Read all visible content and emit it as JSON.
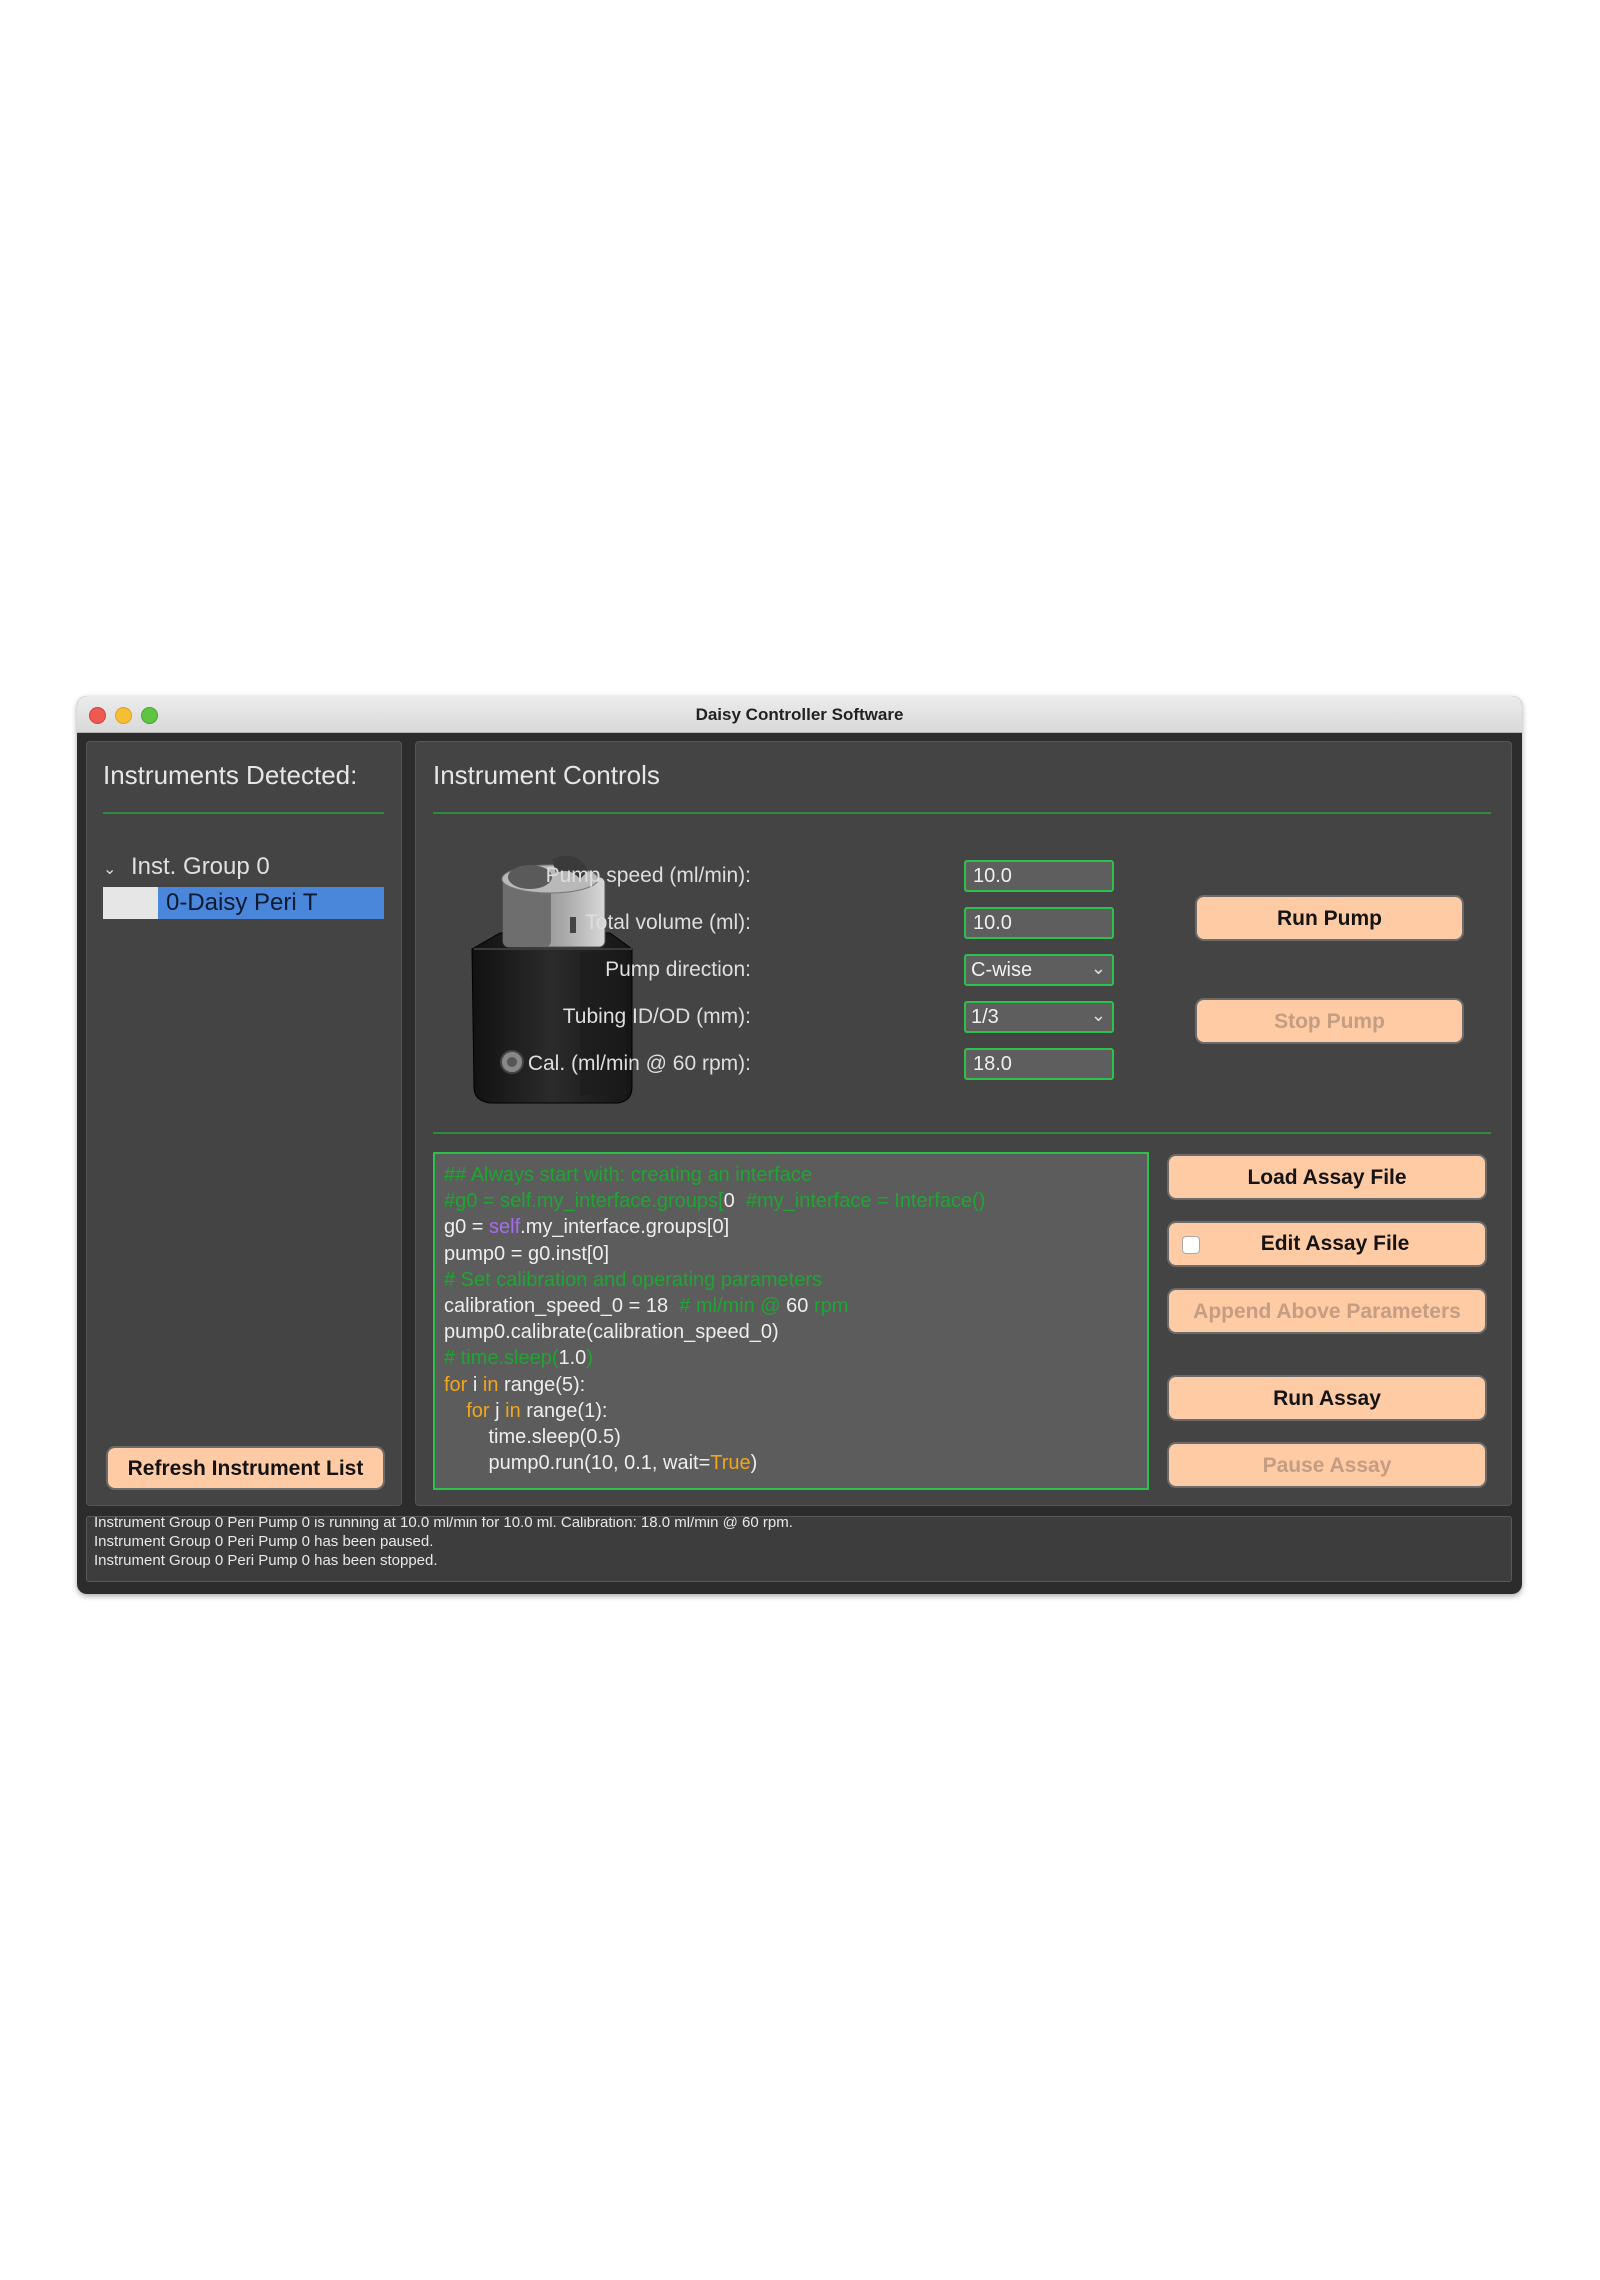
{
  "window": {
    "title": "Daisy Controller Software"
  },
  "instruments_panel": {
    "heading": "Instruments Detected:",
    "tree": {
      "group_label": "Inst. Group 0",
      "item_label": "0-Daisy Peri T"
    },
    "refresh_button": "Refresh Instrument List"
  },
  "controls_panel": {
    "heading": "Instrument Controls",
    "fields": {
      "pump_speed": {
        "label": "Pump speed (ml/min):",
        "value": "10.0"
      },
      "total_volume": {
        "label": "Total volume (ml):",
        "value": "10.0"
      },
      "pump_direction": {
        "label": "Pump direction:",
        "value": "C-wise"
      },
      "tubing": {
        "label": "Tubing ID/OD (mm):",
        "value": "1/3"
      },
      "calibration": {
        "label": "Cal. (ml/min @ 60 rpm):",
        "value": "18.0"
      }
    },
    "run_pump_button": "Run Pump",
    "stop_pump_button": "Stop Pump"
  },
  "assay": {
    "code_lines": [
      [
        {
          "t": "## Always start with: creating an interface",
          "c": "comment"
        }
      ],
      [
        {
          "t": "#g0 = self.my_interface.groups[",
          "c": "comment"
        },
        {
          "t": "0",
          "c": "plain"
        },
        {
          "t": "  #my_interface = Interface()",
          "c": "comment"
        }
      ],
      [
        {
          "t": "g0 = ",
          "c": "plain"
        },
        {
          "t": "self",
          "c": "self"
        },
        {
          "t": ".my_interface.groups[0]",
          "c": "plain"
        }
      ],
      [
        {
          "t": "pump0 = g0.inst[0]",
          "c": "plain"
        }
      ],
      [
        {
          "t": "# Set calibration and operating parameters",
          "c": "comment"
        }
      ],
      [
        {
          "t": "calibration_speed_0 = 18  ",
          "c": "plain"
        },
        {
          "t": "# ml/min @ ",
          "c": "comment"
        },
        {
          "t": "60",
          "c": "plain"
        },
        {
          "t": " rpm",
          "c": "comment"
        }
      ],
      [
        {
          "t": "pump0.calibrate(calibration_speed_0)",
          "c": "plain"
        }
      ],
      [
        {
          "t": "# time.sleep(",
          "c": "comment"
        },
        {
          "t": "1.0",
          "c": "plain"
        },
        {
          "t": ")",
          "c": "comment"
        }
      ],
      [
        {
          "t": "for",
          "c": "keyword"
        },
        {
          "t": " i ",
          "c": "plain"
        },
        {
          "t": "in",
          "c": "keyword"
        },
        {
          "t": " range(5):",
          "c": "plain"
        }
      ],
      [
        {
          "t": "    ",
          "c": "plain"
        },
        {
          "t": "for",
          "c": "keyword"
        },
        {
          "t": " j ",
          "c": "plain"
        },
        {
          "t": "in",
          "c": "keyword"
        },
        {
          "t": " range(1):",
          "c": "plain"
        }
      ],
      [
        {
          "t": "        time.sleep(0.5)",
          "c": "plain"
        }
      ],
      [
        {
          "t": "        pump0.run(10, 0.1, wait=",
          "c": "plain"
        },
        {
          "t": "True",
          "c": "keyword"
        },
        {
          "t": ")",
          "c": "plain"
        }
      ]
    ],
    "load_button": "Load Assay File",
    "edit_button": "Edit Assay File",
    "edit_checked": false,
    "append_button": "Append Above Parameters",
    "run_button": "Run Assay",
    "pause_button": "Pause Assay"
  },
  "log": {
    "lines": [
      "Instrument Group 0 Peri Pump 0 is running at  10.0 ml/min for 10.0 ml. Calibration: 18.0 ml/min @ 60 rpm.",
      "Instrument Group 0 Peri Pump 0 has been paused.",
      "Instrument Group 0 Peri Pump 0 has been stopped."
    ]
  },
  "colors": {
    "accent_button": "#ffcba4",
    "field_border": "#2fbf4b",
    "selection": "#4a86d9",
    "comment": "#1ea532",
    "keyword": "#f2a51d",
    "self": "#a56cf0"
  }
}
